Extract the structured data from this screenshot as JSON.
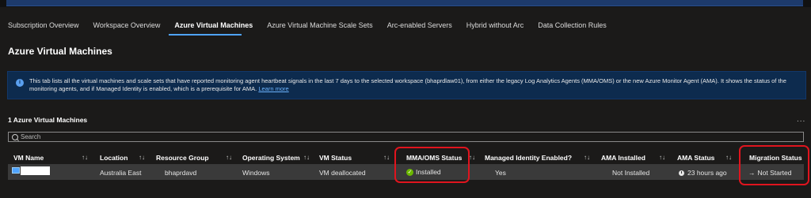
{
  "tabs": [
    {
      "label": "Subscription Overview",
      "active": false
    },
    {
      "label": "Workspace Overview",
      "active": false
    },
    {
      "label": "Azure Virtual Machines",
      "active": true
    },
    {
      "label": "Azure Virtual Machine Scale Sets",
      "active": false
    },
    {
      "label": "Arc-enabled Servers",
      "active": false
    },
    {
      "label": "Hybrid without Arc",
      "active": false
    },
    {
      "label": "Data Collection Rules",
      "active": false
    }
  ],
  "page_title": "Azure Virtual Machines",
  "info": {
    "icon": "info-icon",
    "text": "This tab lists all the virtual machines and scale sets that have reported monitoring agent heartbeat signals in the last 7 days to the selected workspace (bhaprdlaw01), from either the legacy Log Analytics Agents (MMA/OMS) or the new Azure Monitor Agent (AMA). It shows the status of the monitoring agents, and if Managed Identity is enabled, which is a prerequisite for AMA.",
    "link": "Learn more"
  },
  "grid": {
    "title": "1 Azure Virtual Machines",
    "more": "...",
    "search_placeholder": "Search",
    "columns": [
      {
        "label": "VM Name",
        "sort": "↑↓"
      },
      {
        "label": "Location",
        "sort": "↑↓"
      },
      {
        "label": "Resource Group",
        "sort": "↑↓"
      },
      {
        "label": "Operating System",
        "sort": "↑↓"
      },
      {
        "label": "VM Status",
        "sort": "↑↓"
      },
      {
        "label": "MMA/OMS Status",
        "sort": "↑↓"
      },
      {
        "label": "Managed Identity Enabled?",
        "sort": "↑↓"
      },
      {
        "label": "AMA Installed",
        "sort": "↑↓"
      },
      {
        "label": "AMA Status",
        "sort": "↑↓"
      },
      {
        "label": "Migration Status",
        "sort": ""
      }
    ],
    "row": {
      "vm_name": "",
      "location": "Australia East",
      "resource_group": "bhaprdavd",
      "os": "Windows",
      "vm_status": "VM deallocated",
      "mma_status": "Installed",
      "managed_identity": "Yes",
      "ama_installed": "Not Installed",
      "ama_status": "23 hours ago",
      "migration_status": "Not Started"
    }
  },
  "colors": {
    "accent": "#4fa3ff",
    "highlight": "#e0141e",
    "info_bg": "#0d2b4e",
    "success": "#6bb700"
  }
}
